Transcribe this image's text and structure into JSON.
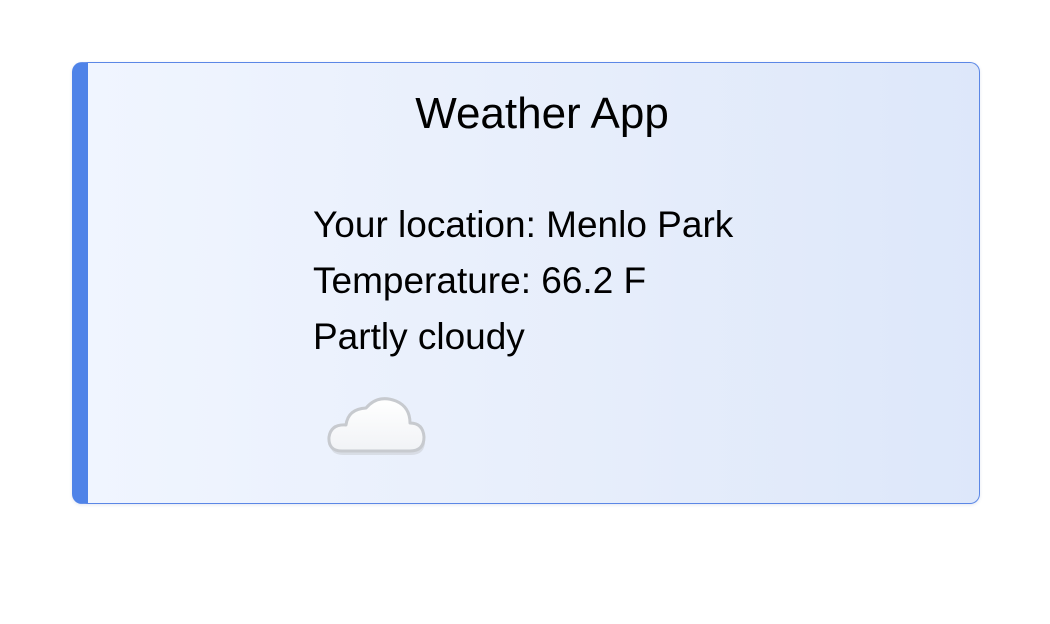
{
  "app": {
    "title": "Weather App"
  },
  "weather": {
    "location_line": "Your location: Menlo Park",
    "temperature_line": "Temperature: 66.2 F",
    "condition": "Partly cloudy",
    "icon": "night-partly-cloudy-icon"
  },
  "colors": {
    "accent": "#4f83e8",
    "moon": "#2f6fdc",
    "card_background": "#e7eefb"
  }
}
